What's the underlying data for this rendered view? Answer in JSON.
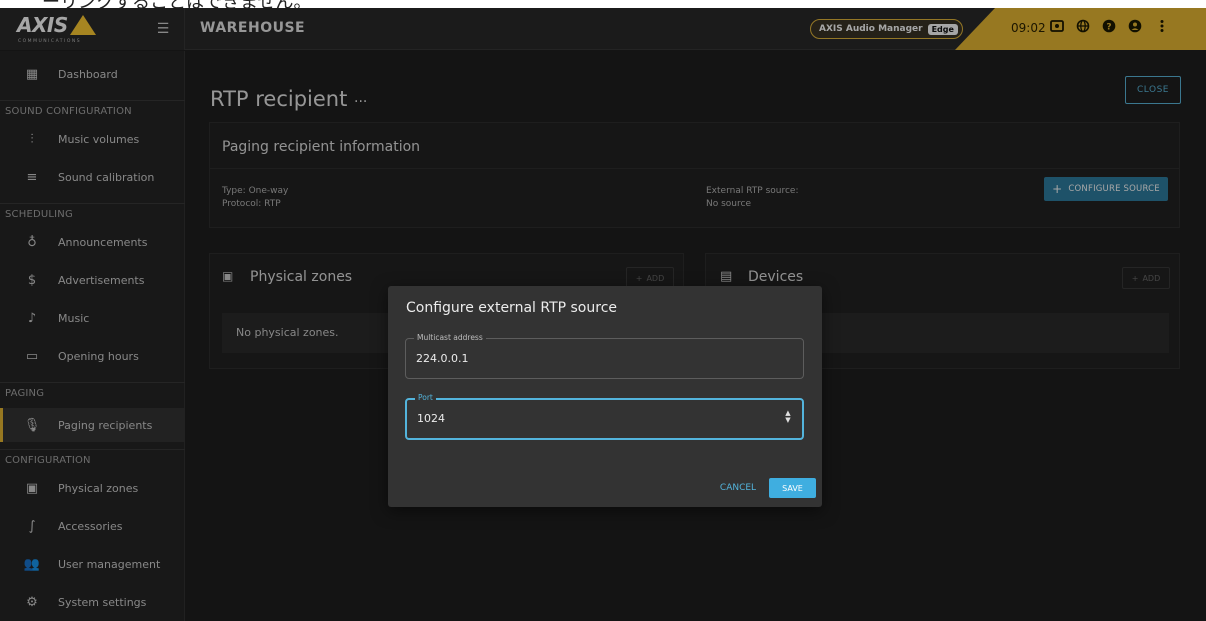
{
  "caption": "ーリンクすることはできません。",
  "header": {
    "logo_text": "AXIS",
    "logo_sub": "COMMUNICATIONS",
    "title": "WAREHOUSE",
    "product": "AXIS Audio Manager",
    "edition": "Edge",
    "clock": "09:02",
    "icons": [
      "display-icon",
      "globe-icon",
      "help-icon",
      "user-icon",
      "more-vert-icon"
    ]
  },
  "sidebar": {
    "dashboard": "Dashboard",
    "sections": {
      "sound": "SOUND CONFIGURATION",
      "scheduling": "SCHEDULING",
      "paging": "PAGING",
      "configuration": "CONFIGURATION"
    },
    "items": {
      "music_volumes": "Music volumes",
      "sound_calibration": "Sound calibration",
      "announcements": "Announcements",
      "advertisements": "Advertisements",
      "music": "Music",
      "opening_hours": "Opening hours",
      "paging_recipients": "Paging recipients",
      "physical_zones": "Physical zones",
      "accessories": "Accessories",
      "user_management": "User management",
      "system_settings": "System settings"
    },
    "active_item": "paging_recipients"
  },
  "page": {
    "title": "RTP recipient",
    "title_menu": "···",
    "close_label": "CLOSE",
    "info_card": {
      "title": "Paging recipient information",
      "type": "Type: One-way",
      "protocol": "Protocol: RTP",
      "external_label": "External RTP source:",
      "external_value": "No source",
      "configure_label": "CONFIGURE SOURCE"
    },
    "zones_card": {
      "title": "Physical zones",
      "add_label": "ADD",
      "empty_text": "No physical zones."
    },
    "devices_card": {
      "title": "Devices",
      "add_label": "ADD"
    }
  },
  "dialog": {
    "title": "Configure external RTP source",
    "multicast": {
      "label": "Multicast address",
      "value": "224.0.0.1"
    },
    "port": {
      "label": "Port",
      "value": "1024"
    },
    "cancel_label": "CANCEL",
    "save_label": "SAVE"
  },
  "colors": {
    "accent_gold": "#e8b933",
    "accent_blue": "#53b4dc",
    "background": "#1f1f1f"
  }
}
